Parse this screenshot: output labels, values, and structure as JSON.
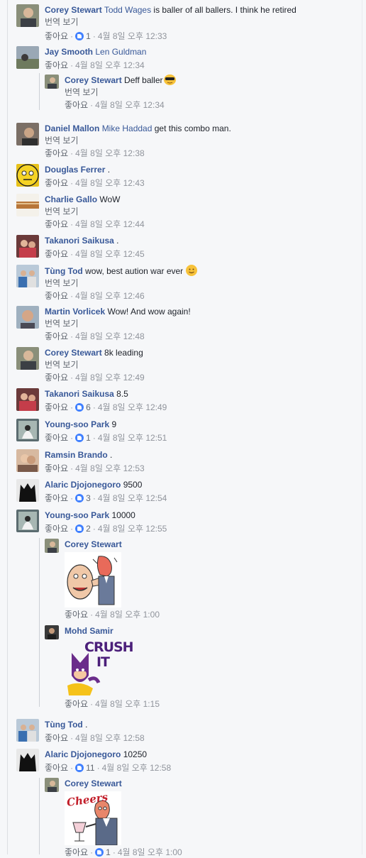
{
  "ui": {
    "like": "좋아요",
    "translate": "번역 보기",
    "dot": "·"
  },
  "comments": [
    {
      "name": "Corey Stewart",
      "tag": "Todd Wages",
      "text": " is baller of all ballers. I think he retired",
      "translate": true,
      "reactions": "1",
      "time": "4월 8일 오후 12:33"
    },
    {
      "name": "Jay Smooth",
      "tag": "Len Guldman",
      "text": "",
      "translate": false,
      "reactions": "",
      "time": "4월 8일 오후 12:34"
    },
    {
      "name": "Corey Stewart",
      "tag": "",
      "text": "Deff baller",
      "translate": true,
      "reactions": "",
      "time": "4월 8일 오후 12:34"
    },
    {
      "name": "Daniel Mallon",
      "tag": "Mike Haddad",
      "text": " get this combo man.",
      "translate": true,
      "reactions": "",
      "time": "4월 8일 오후 12:38"
    },
    {
      "name": "Douglas Ferrer",
      "tag": "",
      "text": ".",
      "translate": false,
      "reactions": "",
      "time": "4월 8일 오후 12:43"
    },
    {
      "name": "Charlie Gallo",
      "tag": "",
      "text": "WoW",
      "translate": true,
      "reactions": "",
      "time": "4월 8일 오후 12:44"
    },
    {
      "name": "Takanori Saikusa",
      "tag": "",
      "text": ".",
      "translate": false,
      "reactions": "",
      "time": "4월 8일 오후 12:45"
    },
    {
      "name": "Tùng Tod",
      "tag": "",
      "text": "wow, best aution war ever",
      "translate": true,
      "reactions": "",
      "time": "4월 8일 오후 12:46"
    },
    {
      "name": "Martin Vorlicek",
      "tag": "",
      "text": "Wow! And wow again!",
      "translate": true,
      "reactions": "",
      "time": "4월 8일 오후 12:48"
    },
    {
      "name": "Corey Stewart",
      "tag": "",
      "text": "8k leading",
      "translate": true,
      "reactions": "",
      "time": "4월 8일 오후 12:49"
    },
    {
      "name": "Takanori Saikusa",
      "tag": "",
      "text": "8.5",
      "translate": false,
      "reactions": "6",
      "time": "4월 8일 오후 12:49"
    },
    {
      "name": "Young-soo Park",
      "tag": "",
      "text": "9",
      "translate": false,
      "reactions": "1",
      "time": "4월 8일 오후 12:51"
    },
    {
      "name": "Ramsin Brando",
      "tag": "",
      "text": ".",
      "translate": false,
      "reactions": "",
      "time": "4월 8일 오후 12:53"
    },
    {
      "name": "Alaric Djojonegoro",
      "tag": "",
      "text": "9500",
      "translate": false,
      "reactions": "3",
      "time": "4월 8일 오후 12:54"
    },
    {
      "name": "Young-soo Park",
      "tag": "",
      "text": "10000",
      "translate": false,
      "reactions": "2",
      "time": "4월 8일 오후 12:55"
    },
    {
      "name": "Corey Stewart",
      "tag": "",
      "text": "",
      "translate": false,
      "reactions": "",
      "time": "4월 8일 오후 1:00"
    },
    {
      "name": "Mohd Samir",
      "tag": "",
      "text": "",
      "translate": false,
      "reactions": "",
      "time": "4월 8일 오후 1:15",
      "sticker_text": "CRUSH IT"
    },
    {
      "name": "Tùng Tod",
      "tag": "",
      "text": ".",
      "translate": false,
      "reactions": "",
      "time": "4월 8일 오후 12:58"
    },
    {
      "name": "Alaric Djojonegoro",
      "tag": "",
      "text": "10250",
      "translate": false,
      "reactions": "11",
      "time": "4월 8일 오후 12:58"
    },
    {
      "name": "Corey Stewart",
      "tag": "",
      "text": "",
      "translate": false,
      "reactions": "1",
      "time": "4월 8일 오후 1:00",
      "sticker_text": "Cheers"
    }
  ],
  "colors": {
    "link": "#385898",
    "meta": "#90949c",
    "reaction": "#4080ff",
    "bg": "#f6f7f9"
  }
}
